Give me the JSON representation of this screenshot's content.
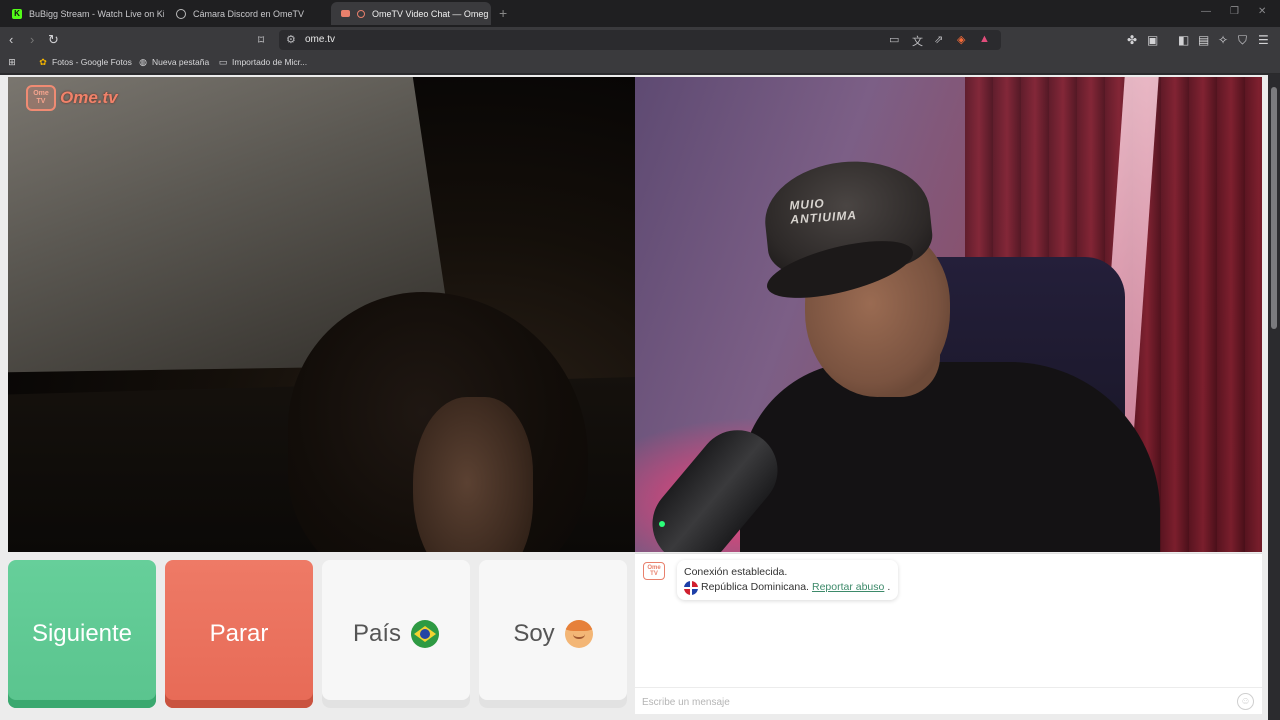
{
  "tabs": [
    {
      "label": "BuBigg Stream - Watch Live on Kick",
      "active": false,
      "favicon": "kick-icon",
      "favicon_color": "#53fc18"
    },
    {
      "label": "Cámara Discord en OmeTV",
      "active": false,
      "favicon": "globe-icon",
      "favicon_color": "#bbbbbb"
    },
    {
      "label": "OmeTV Video Chat — Omeg",
      "active": true,
      "favicon": "ometv-icon",
      "favicon_color": "#e8806c"
    }
  ],
  "address_bar": {
    "url": "ome.tv"
  },
  "bookmarks": [
    {
      "label": "Fotos - Google Fotos",
      "icon": "google-photos-icon"
    },
    {
      "label": "Nueva pestaña",
      "icon": "globe-icon"
    },
    {
      "label": "Importado de Micr...",
      "icon": "folder-icon"
    }
  ],
  "logo": {
    "badge_line1": "Ome",
    "badge_line2": "TV",
    "text": "Ome.tv"
  },
  "remote_video": {
    "cap_text_line1": "MUIO",
    "cap_text_line2": "ANTIUIMA"
  },
  "controls": {
    "next_label": "Siguiente",
    "stop_label": "Parar",
    "country_label": "País",
    "country_flag": "brazil-flag-icon",
    "gender_label": "Soy",
    "gender_icon": "boy-face-icon"
  },
  "chat": {
    "logo_line1": "Ome",
    "logo_line2": "TV",
    "status": "Conexión establecida.",
    "country": "República Dominicana.",
    "country_flag": "dominican-republic-flag-icon",
    "report_link": "Reportar abuso",
    "report_suffix": ".",
    "input_placeholder": "Escribe un mensaje"
  },
  "colors": {
    "next_button": "#5ac48e",
    "stop_button": "#e76a56",
    "neutral_button": "#f7f7f7",
    "brand": "#f0826a",
    "link": "#3d8a6a"
  }
}
